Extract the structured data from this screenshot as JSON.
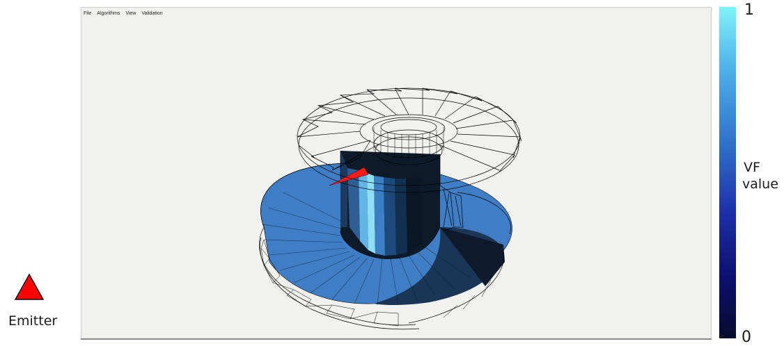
{
  "menu": {
    "file": "File",
    "algorithms": "Algorithms",
    "view": "View",
    "validation": "Validation"
  },
  "colorbar": {
    "max_label": "1",
    "min_label": "0",
    "title_line1": "VF",
    "title_line2": "value",
    "colors": [
      "#7ff4fa",
      "#4fb3ea",
      "#2e6fc9",
      "#1d2fa8",
      "#0c0f6e",
      "#070b2c"
    ]
  },
  "legend": {
    "label": "Emitter",
    "icon": "emitter-triangle-icon",
    "color": "#ff0000"
  },
  "scene": {
    "wireframe_color": "#000000",
    "emitter_color": "#ff1a1a",
    "shading_colors": [
      "#3e7ec6",
      "#2c5e9a",
      "#1a3556",
      "#0b1522",
      "#7ee0f4"
    ]
  }
}
